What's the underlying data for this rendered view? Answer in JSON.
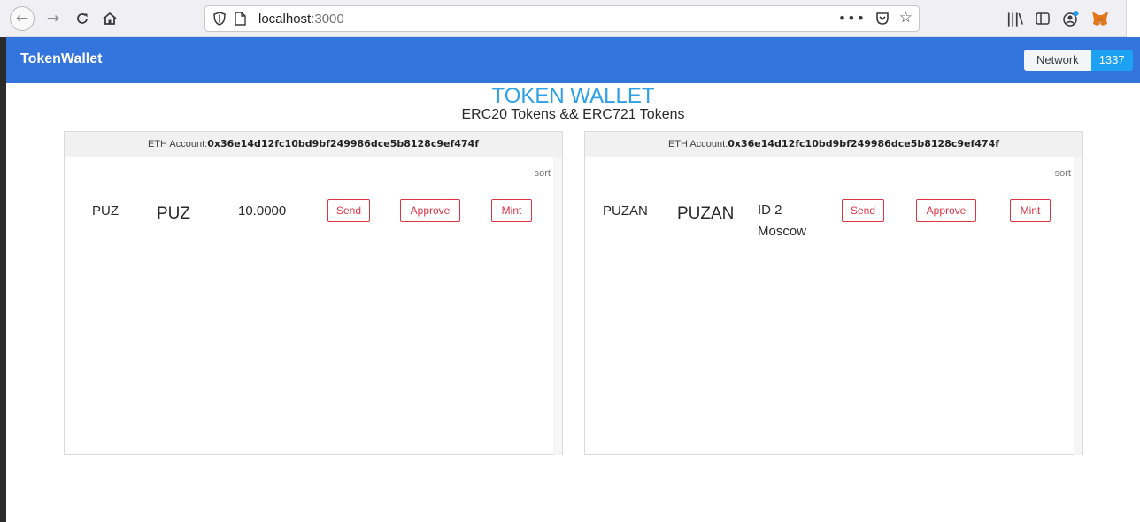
{
  "browser": {
    "url_host": "localhost",
    "url_port": ":3000"
  },
  "app": {
    "brand": "TokenWallet",
    "network_label": "Network",
    "network_id": "1337"
  },
  "page": {
    "title": "TOKEN WALLET",
    "subtitle": "ERC20 Tokens && ERC721 Tokens"
  },
  "erc20_panel": {
    "account_label": "ETH Account:",
    "account": "0x36e14d12fc10bd9bf249986dce5b8128c9ef474f",
    "sort_label": "sort",
    "row": {
      "symbol": "PUZ",
      "name": "PUZ",
      "balance": "10.0000",
      "send_label": "Send",
      "approve_label": "Approve",
      "mint_label": "Mint"
    }
  },
  "erc721_panel": {
    "account_label": "ETH Account:",
    "account": "0x36e14d12fc10bd9bf249986dce5b8128c9ef474f",
    "sort_label": "sort",
    "row": {
      "symbol": "PUZAN",
      "name": "PUZAN",
      "token_id": "ID 2",
      "token_meta": "Moscow",
      "send_label": "Send",
      "approve_label": "Approve",
      "mint_label": "Mint"
    }
  },
  "colors": {
    "navbar": "#3475dd",
    "title": "#2ea1e6",
    "danger": "#dc3545",
    "network_badge": "#1da1f2"
  }
}
